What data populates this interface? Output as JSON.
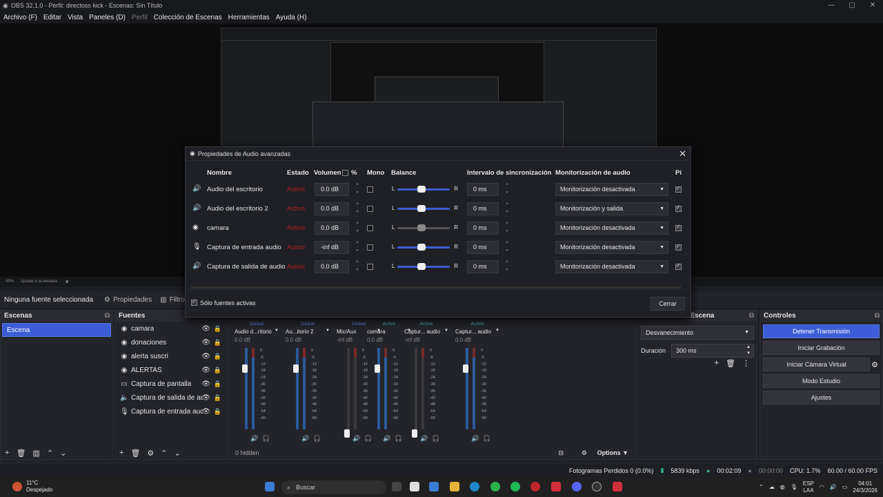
{
  "window": {
    "title": "OBS 32.1.0 - Perfil: directoss kick - Escenas: Sin Título"
  },
  "menu": [
    "Archivo (F)",
    "Editar",
    "Vista",
    "Paneles (D)",
    "Perfil",
    "Colección de Escenas",
    "Herramientas",
    "Ayuda (H)"
  ],
  "zoombar": {
    "zoom": "49%",
    "fit": "Ajustar a la ventana"
  },
  "sourcebar": {
    "no_source": "Ninguna fuente seleccionada",
    "properties": "Propiedades",
    "filters": "Filtros"
  },
  "scenes": {
    "title": "Escenas",
    "items": [
      "Escena"
    ]
  },
  "sources": {
    "title": "Fuentes",
    "items": [
      {
        "icon": "camera-icon",
        "glyph": "◉",
        "label": "camara"
      },
      {
        "icon": "browser-icon",
        "glyph": "◉",
        "label": "donaciones"
      },
      {
        "icon": "browser-icon",
        "glyph": "◉",
        "label": "alerta suscri"
      },
      {
        "icon": "browser-icon",
        "glyph": "◉",
        "label": "ALERTAS"
      },
      {
        "icon": "monitor-icon",
        "glyph": "▭",
        "label": "Captura de pantalla"
      },
      {
        "icon": "speaker-icon",
        "glyph": "🔈",
        "label": "Captura de salida de audio"
      },
      {
        "icon": "mic-icon",
        "glyph": "🎙",
        "label": "Captura de entrada audio"
      }
    ]
  },
  "mixer": {
    "channels": [
      {
        "badge": "Global",
        "name": "Audio d...ritorio",
        "db": "0.0 dB",
        "level": 0.8,
        "active": false
      },
      {
        "badge": "Global",
        "name": "Au...itorio 2",
        "db": "0.0 dB",
        "level": 0.8,
        "active": false
      },
      {
        "badge": "Global",
        "name": "Mic/Aux",
        "db": "-inf dB",
        "level": 0.0,
        "active": false
      },
      {
        "badge": "Active",
        "name": "camara",
        "db": "0.0 dB",
        "level": 0.8,
        "active": true
      },
      {
        "badge": "Active",
        "name": "Captur... audio",
        "db": "-inf dB",
        "level": 0.0,
        "active": true
      },
      {
        "badge": "Active",
        "name": "Captur... audio",
        "db": "0.0 dB",
        "level": 0.8,
        "active": true
      }
    ],
    "ticks": [
      "0",
      "-6",
      "-12",
      "-18",
      "-24",
      "-30",
      "-36",
      "-42",
      "-48",
      "-54",
      "-60"
    ],
    "hidden": "0 hidden",
    "options": "Options"
  },
  "transitions": {
    "title": "Transiciones de escena",
    "title_visible": "...Escena",
    "type": "Desvanecimiento",
    "duration_label": "Duración",
    "duration": "300 ms"
  },
  "controls": {
    "title": "Controles",
    "buttons": [
      "Detener Transmisión",
      "Iniciar Grabación",
      "Iniciar Cámara Virtual",
      "Modo Estudio",
      "Ajustes"
    ]
  },
  "status": {
    "dropped": "Fotogramas Perdidos 0 (0.0%)",
    "bitrate": "5839 kbps",
    "live": "00:02:09",
    "rec": "00:00:00",
    "cpu": "CPU: 1.7%",
    "fps": "60.00 / 60.00 FPS"
  },
  "dialog": {
    "title": "Propiedades de Audio avanzadas",
    "headers": {
      "name": "Nombre",
      "state": "Estado",
      "volume": "Volumen",
      "percent": "%",
      "mono": "Mono",
      "balance": "Balance",
      "sync": "Intervalo de sincronización",
      "monitor": "Monitorización de audio",
      "tracks": "Pi"
    },
    "rows": [
      {
        "glyph": "🔊",
        "name": "Audio del escritorio",
        "state": "Activo",
        "volume": "0.0 dB",
        "sync": "0 ms",
        "monitor": "Monitorización desactivada",
        "balance_on": true
      },
      {
        "glyph": "🔊",
        "name": "Audio del escritorio 2",
        "state": "Activo",
        "volume": "0.0 dB",
        "sync": "0 ms",
        "monitor": "Monitorización y salida",
        "balance_on": true
      },
      {
        "glyph": "◉",
        "name": "camara",
        "state": "Activo",
        "volume": "0.0 dB",
        "sync": "0 ms",
        "monitor": "Monitorización desactivada",
        "balance_on": false
      },
      {
        "glyph": "🎙",
        "name": "Captura de entrada audio",
        "state": "Activo",
        "volume": "-inf dB",
        "sync": "0 ms",
        "monitor": "Monitorización desactivada",
        "balance_on": true
      },
      {
        "glyph": "🔊",
        "name": "Captura de salida de audio",
        "state": "Activo",
        "volume": "0.0 dB",
        "sync": "0 ms",
        "monitor": "Monitorización desactivada",
        "balance_on": true
      }
    ],
    "balance_l": "L",
    "balance_r": "R",
    "active_only": "Sólo fuentes activas",
    "close": "Cerrar"
  },
  "taskbar": {
    "weather_temp": "11°C",
    "weather_desc": "Despejado",
    "search": "Buscar",
    "lang": "ESP",
    "lang2": "LAA",
    "time": "04:01",
    "date": "24/3/2026"
  }
}
